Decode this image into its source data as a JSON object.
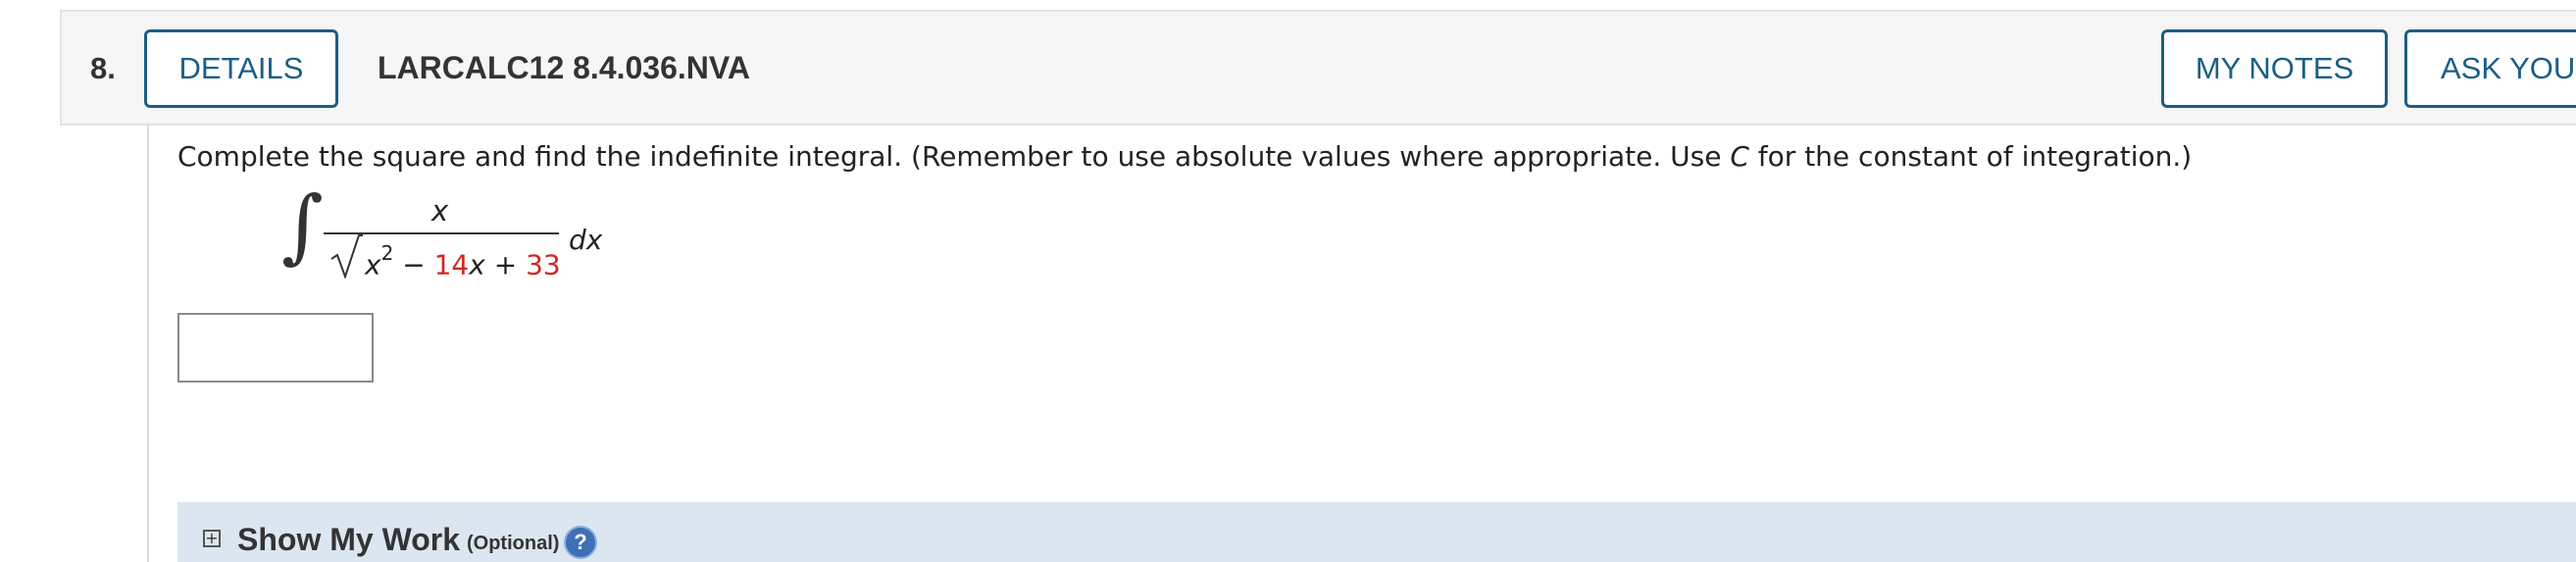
{
  "question": {
    "number": "8.",
    "details_label": "DETAILS",
    "id": "LARCALC12 8.4.036.NVA",
    "my_notes_label": "MY NOTES",
    "ask_label": "ASK YOUR TEACHER"
  },
  "prompt": {
    "before_c": "Complete the square and find the indefinite integral. (Remember to use absolute values where appropriate. Use ",
    "c": "C",
    "after_c": " for the constant of integration.)"
  },
  "integral": {
    "sign": "∫",
    "numerator": "x",
    "radicand_x": "x",
    "radicand_exp": "2",
    "minus": " − ",
    "coef": "14",
    "x2": "x",
    "plus": " + ",
    "const": "33",
    "dx": "dx"
  },
  "answer": {
    "value": "",
    "placeholder": ""
  },
  "show_my_work": {
    "icon": "plus-box-icon",
    "plus_glyph": "+",
    "title": "Show My Work",
    "optional": "(Optional)",
    "help_glyph": "?"
  },
  "colors": {
    "accent": "#1b5e86",
    "highlight_red": "#d2281e",
    "panel_bg": "#dbe6f0",
    "help_blue": "#3f6fb6"
  }
}
